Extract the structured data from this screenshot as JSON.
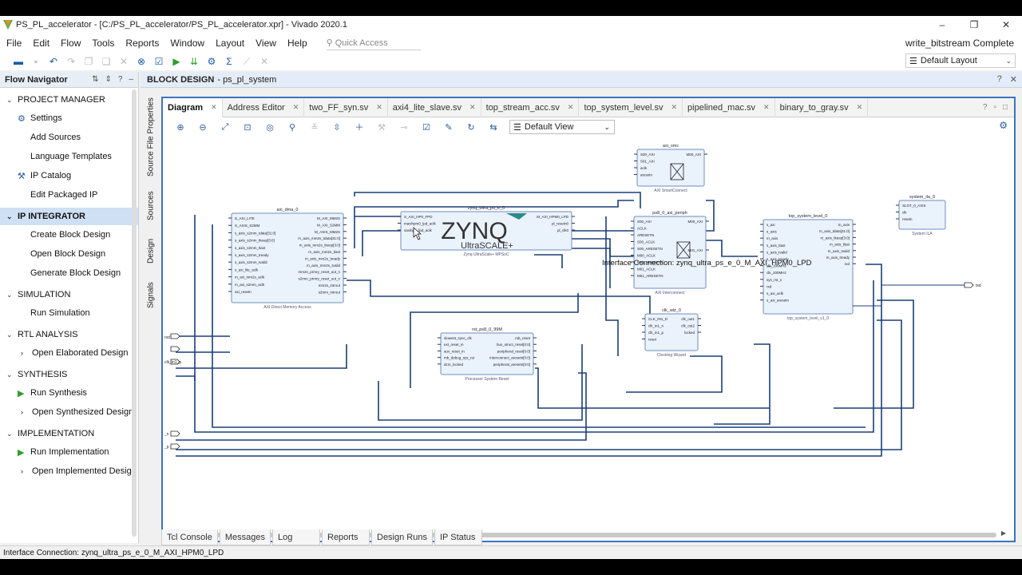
{
  "window": {
    "title": "PS_PL_accelerator - [C:/PS_PL_accelerator/PS_PL_accelerator.xpr] - Vivado 2020.1",
    "minimize": "–",
    "maximize": "❐",
    "close": "✕"
  },
  "menu": {
    "items": [
      "File",
      "Edit",
      "Flow",
      "Tools",
      "Reports",
      "Window",
      "Layout",
      "View",
      "Help"
    ],
    "quick_access_placeholder": "Quick Access",
    "status": "write_bitstream Complete"
  },
  "layout_select": "Default Layout",
  "flow_navigator": {
    "title": "Flow Navigator",
    "sections": [
      {
        "label": "PROJECT MANAGER",
        "items": [
          {
            "label": "Settings",
            "icon": "gear-icon"
          },
          {
            "label": "Add Sources"
          },
          {
            "label": "Language Templates"
          },
          {
            "label": "IP Catalog",
            "icon": "ip-icon"
          },
          {
            "label": "Edit Packaged IP"
          }
        ]
      },
      {
        "label": "IP INTEGRATOR",
        "items": [
          {
            "label": "Create Block Design"
          },
          {
            "label": "Open Block Design"
          },
          {
            "label": "Generate Block Design"
          }
        ]
      },
      {
        "label": "SIMULATION",
        "items": [
          {
            "label": "Run Simulation"
          }
        ]
      },
      {
        "label": "RTL ANALYSIS",
        "items": [
          {
            "label": "Open Elaborated Design",
            "expander": true
          }
        ]
      },
      {
        "label": "SYNTHESIS",
        "items": [
          {
            "label": "Run Synthesis",
            "icon": "run-icon"
          },
          {
            "label": "Open Synthesized Design",
            "expander": true
          }
        ]
      },
      {
        "label": "IMPLEMENTATION",
        "items": [
          {
            "label": "Run Implementation",
            "icon": "run-icon"
          },
          {
            "label": "Open Implemented Design",
            "expander": true
          }
        ]
      }
    ]
  },
  "block_design": {
    "header": "BLOCK DESIGN",
    "design_name": "- ps_pl_system",
    "vertical_tabs": [
      "Source File Properties",
      "Sources",
      "Design",
      "Signals"
    ],
    "tabs": [
      {
        "label": "Diagram",
        "active": true
      },
      {
        "label": "Address Editor"
      },
      {
        "label": "two_FF_syn.sv"
      },
      {
        "label": "axi4_lite_slave.sv"
      },
      {
        "label": "top_stream_acc.sv"
      },
      {
        "label": "top_system_level.sv"
      },
      {
        "label": "pipelined_mac.sv"
      },
      {
        "label": "binary_to_gray.sv"
      }
    ],
    "view_select": "Default View",
    "diagram": {
      "tooltip": "Interface Connection: zynq_ultra_ps_e_0_M_AXI_HPM0_LPD",
      "blocks": {
        "axi_dma": {
          "name": "axi_dma_0",
          "footer": "AXI Direct Memory Access",
          "left_ports": [
            "S_AXI_LITE",
            "S_AXIS_S2MM",
            "s_axis_s2mm_tdata[31:0]",
            "s_axis_s2mm_tkeep[3:0]",
            "s_axis_s2mm_tlast",
            "s_axis_s2mm_tready",
            "s_axis_s2mm_tvalid",
            "s_axi_lite_aclk",
            "m_axi_mm2s_aclk",
            "m_axi_s2mm_aclk",
            "axi_resetn"
          ],
          "right_ports": [
            "M_AXI_MM2S",
            "M_AXI_S2MM",
            "M_AXIS_MM2S",
            "m_axis_mm2s_tdata[31:0]",
            "m_axis_mm2s_tkeep[3:0]",
            "m_axis_mm2s_tlast",
            "m_axis_mm2s_tready",
            "m_axis_mm2s_tvalid",
            "mm2s_prmry_reset_out_n",
            "s2mm_prmry_reset_out_n",
            "mm2s_introut",
            "s2mm_introut"
          ]
        },
        "zynq": {
          "name": "zynq_ultra_ps_e_0",
          "footer": "Zynq UltraScale+ MPSoC",
          "logo": "ZYNQ",
          "logo_sub": "UltraSCALE+",
          "left_ports": [
            "S_AXI_HP0_FPD",
            "maxihpm0_lpd_aclk",
            "saxihp0_fpd_aclk"
          ],
          "right_ports": [
            "M_AXI_HPM0_LPD",
            "pl_resetn0",
            "pl_clk0"
          ]
        },
        "axi_smc": {
          "name": "axi_smc",
          "footer": "AXI SmartConnect",
          "left_ports": [
            "S00_AXI",
            "S01_AXI",
            "aclk",
            "aresetn"
          ],
          "right_ports": [
            "M00_AXI"
          ]
        },
        "periph": {
          "name": "ps8_0_axi_periph",
          "footer": "AXI Interconnect",
          "left_ports": [
            "S00_AXI",
            "ACLK",
            "ARESETN",
            "S00_ACLK",
            "S00_ARESETN",
            "M00_ACLK",
            "M00_ARESETN",
            "M01_ACLK",
            "M01_ARESETN"
          ],
          "right_ports": [
            "M00_AXI",
            "M01_AXI"
          ]
        },
        "top": {
          "name": "top_system_level_0",
          "footer": "top_system_level_v1_0",
          "left_ports": [
            "s_axi",
            "s_axis",
            "m_axis",
            "s_axis_tlast",
            "s_axis_tvalid",
            "s_axis_tready",
            "clk_100MHz",
            "clk_200MHz",
            "sys_rst_n",
            "rxd",
            "s_axi_aclk",
            "s_axi_aresetn"
          ],
          "right_ports": [
            "m_axis",
            "m_axis_tdata[31:0]",
            "m_axis_tkeep[3:0]",
            "m_axis_tlast",
            "m_axis_tvalid",
            "m_axis_tready",
            "txd"
          ]
        },
        "ila": {
          "name": "system_ila_0",
          "footer": "System ILA",
          "left_ports": [
            "SLOT_0_AXIS",
            "clk",
            "resetn"
          ]
        },
        "rst": {
          "name": "rst_ps8_0_99M",
          "footer": "Processor System Reset",
          "left_ports": [
            "slowest_sync_clk",
            "ext_reset_in",
            "aux_reset_in",
            "mb_debug_sys_rst",
            "dcm_locked"
          ],
          "right_ports": [
            "mb_reset",
            "bus_struct_reset[0:0]",
            "peripheral_reset[0:0]",
            "interconnect_aresetn[0:0]",
            "peripheral_aresetn[0:0]"
          ]
        },
        "clk": {
          "name": "clk_wiz_0",
          "footer": "Clocking Wizard",
          "left_ports": [
            "CLK_IN1_D",
            "clk_in1_n",
            "clk_in1_p",
            "reset"
          ],
          "right_ports": [
            "clk_out1",
            "clk_out2",
            "locked"
          ]
        }
      },
      "external_ports": [
        "txd",
        "rxd",
        "clk_in1_n",
        "clk_in1_p",
        "_n",
        "_p"
      ]
    }
  },
  "bottom_tabs": [
    "Tcl Console",
    "Messages",
    "Log",
    "Reports",
    "Design Runs",
    "IP Status"
  ],
  "status_bar": "Interface Connection: zynq_ultra_ps_e_0_M_AXI_HPM0_LPD",
  "colors": {
    "accent": "#3d74c0",
    "wire": "#1b3f78",
    "block_fill": "#eaf2fb",
    "block_stroke": "#6c8fbf",
    "run_green": "#2e9e2e"
  }
}
